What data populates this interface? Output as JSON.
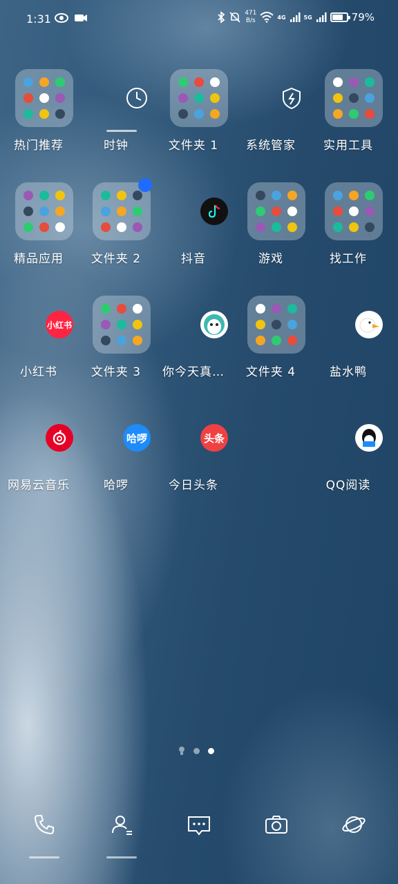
{
  "status_bar": {
    "time": "1:31",
    "speed_value": "471",
    "speed_unit": "B/s",
    "net1": "4G",
    "net2": "5G",
    "battery_pct": "79%",
    "battery_level": 0.79
  },
  "apps": [
    {
      "label": "热门推荐",
      "type": "folder",
      "icon": "hot-recommend-folder"
    },
    {
      "label": "时钟",
      "type": "app",
      "icon": "clock-icon"
    },
    {
      "label": "文件夹 1",
      "type": "folder",
      "icon": "folder-1"
    },
    {
      "label": "系统管家",
      "type": "app",
      "icon": "shield-icon"
    },
    {
      "label": "实用工具",
      "type": "folder",
      "icon": "utilities-folder"
    },
    {
      "label": "精品应用",
      "type": "folder",
      "icon": "featured-apps-folder"
    },
    {
      "label": "文件夹 2",
      "type": "folder",
      "icon": "folder-2"
    },
    {
      "label": "抖音",
      "type": "app",
      "icon": "douyin-icon"
    },
    {
      "label": "游戏",
      "type": "folder",
      "icon": "games-folder"
    },
    {
      "label": "找工作",
      "type": "folder",
      "icon": "job-search-folder"
    },
    {
      "label": "小红书",
      "type": "app",
      "icon": "xiaohongshu-icon",
      "icon_text": "小红书"
    },
    {
      "label": "文件夹 3",
      "type": "folder",
      "icon": "folder-3"
    },
    {
      "label": "你今天真…",
      "type": "app",
      "icon": "panda-app-icon"
    },
    {
      "label": "文件夹 4",
      "type": "folder",
      "icon": "folder-4"
    },
    {
      "label": "盐水鸭",
      "type": "app",
      "icon": "duck-icon"
    },
    {
      "label": "网易云音乐",
      "type": "app",
      "icon": "netease-music-icon"
    },
    {
      "label": "哈啰",
      "type": "app",
      "icon": "hellobike-icon",
      "icon_text": "哈啰"
    },
    {
      "label": "今日头条",
      "type": "app",
      "icon": "toutiao-icon",
      "icon_text": "头条"
    },
    {
      "label": "QQ阅读",
      "type": "app",
      "icon": "qq-reader-icon"
    }
  ],
  "dock": [
    "phone-icon",
    "contacts-icon",
    "messages-icon",
    "camera-icon",
    "browser-icon"
  ],
  "colors": {
    "xiaohongshu": "#ff2442",
    "netease": "#e60026",
    "hellobike": "#1d8cf8",
    "toutiao": "#f04142",
    "badge": "#1f6bff"
  }
}
